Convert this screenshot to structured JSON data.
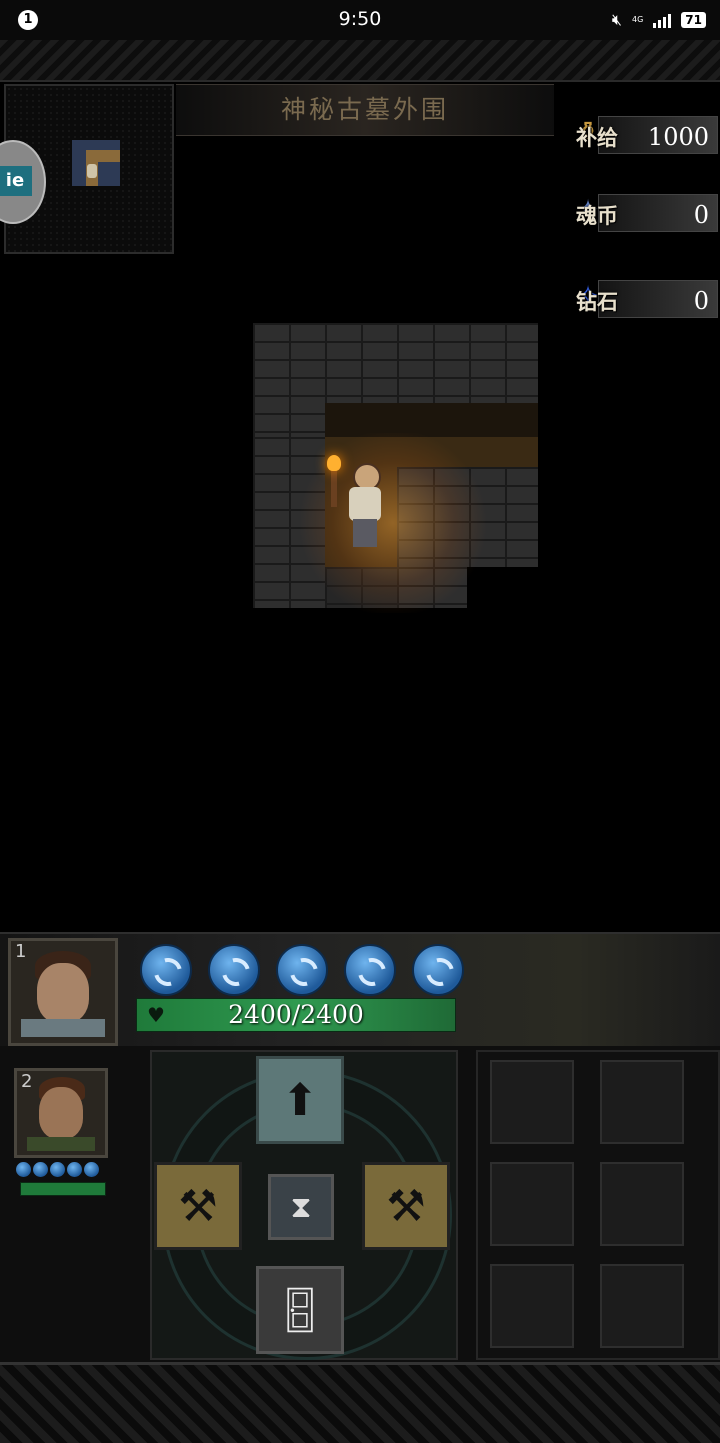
{
  "status_bar": {
    "notification_count": "1",
    "time": "9:50",
    "network": "4G",
    "battery": "71"
  },
  "map": {
    "title": "神秘古墓外围"
  },
  "float_button": {
    "label": "ie"
  },
  "currencies": [
    {
      "label": "补给",
      "value": "1000",
      "icon": "supply-icon",
      "color": "#d8b060"
    },
    {
      "label": "魂币",
      "value": "0",
      "icon": "soul-coin-icon",
      "color": "#6a8ad0"
    },
    {
      "label": "钻石",
      "value": "0",
      "icon": "diamond-icon",
      "color": "#3a6aff"
    }
  ],
  "heroes": [
    {
      "slot": "1",
      "hp": "2400/2400",
      "hp_fraction": 1.0,
      "energy_orbs": 5
    },
    {
      "slot": "2",
      "hp_fraction": 1.0,
      "energy_orbs": 5
    }
  ],
  "controls": {
    "up_icon": "arrow-up-icon",
    "left_icon": "shovel-icon",
    "right_icon": "shovel-icon",
    "wait_icon": "hourglass-icon",
    "door_icon": "door-icon"
  },
  "inventory": {
    "slot_count": 6
  }
}
